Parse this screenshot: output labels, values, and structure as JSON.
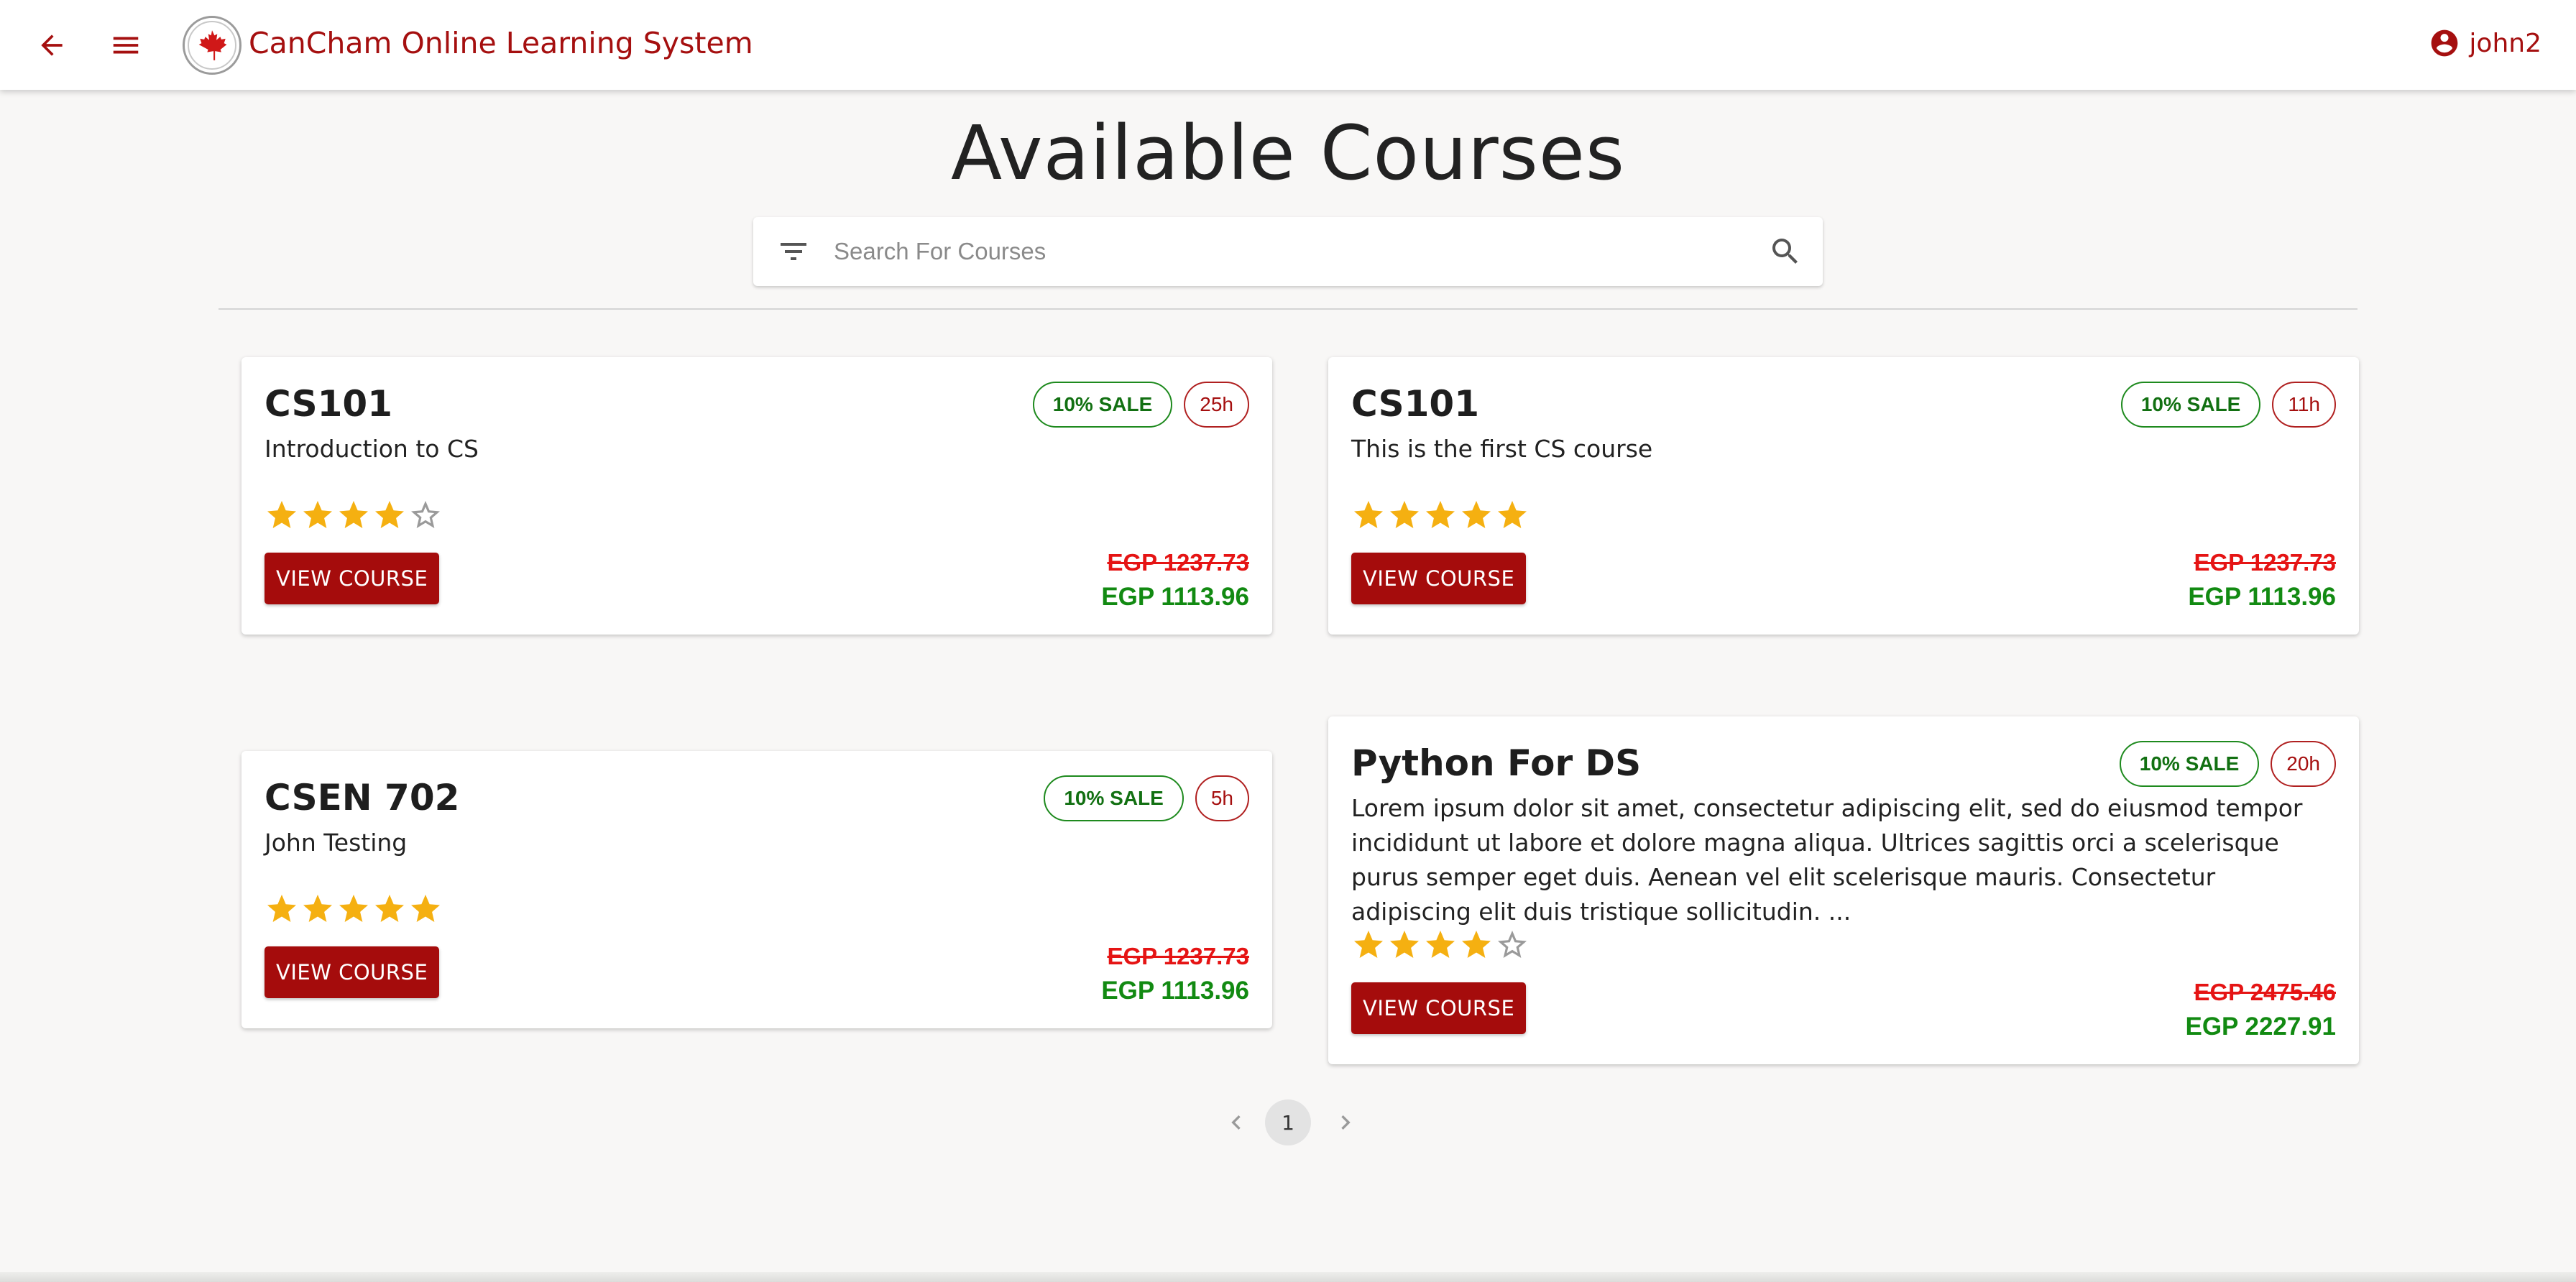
{
  "app": {
    "title": "CanCham Online Learning System",
    "user_name": "john2",
    "brand_color": "#a50f0f"
  },
  "page": {
    "title": "Available Courses",
    "search_placeholder": "Search For Courses"
  },
  "courses": [
    {
      "title": "CS101",
      "description": "Introduction to CS",
      "sale": "10% SALE",
      "duration": "25h",
      "rating": 4,
      "old_price": "EGP 1237.73",
      "new_price": "EGP 1113.96",
      "button": "VIEW COURSE"
    },
    {
      "title": "CS101",
      "description": "This is the first CS course",
      "sale": "10% SALE",
      "duration": "11h",
      "rating": 5,
      "old_price": "EGP 1237.73",
      "new_price": "EGP 1113.96",
      "button": "VIEW COURSE"
    },
    {
      "title": "CSEN 702",
      "description": "John Testing",
      "sale": "10% SALE",
      "duration": "5h",
      "rating": 5,
      "old_price": "EGP 1237.73",
      "new_price": "EGP 1113.96",
      "button": "VIEW COURSE"
    },
    {
      "title": "Python For DS",
      "description": "Lorem ipsum dolor sit amet, consectetur adipiscing elit, sed do eiusmod tempor incididunt ut labore et dolore magna aliqua. Ultrices sagittis orci a scelerisque purus semper eget duis. Aenean vel elit scelerisque mauris. Consectetur adipiscing elit duis tristique sollicitudin. ...",
      "sale": "10% SALE",
      "duration": "20h",
      "rating": 4,
      "old_price": "EGP 2475.46",
      "new_price": "EGP 2227.91",
      "button": "VIEW COURSE"
    }
  ],
  "pagination": {
    "current_page": "1"
  },
  "icons": {
    "back": "arrow-back-icon",
    "menu": "hamburger-menu-icon",
    "logo": "cancham-maple-leaf-logo",
    "user": "account-circle-icon",
    "filter": "filter-icon",
    "search": "search-icon",
    "star_filled": "star-filled-icon",
    "star_empty": "star-outline-icon"
  },
  "colors": {
    "sale_green": "#128a12",
    "price_strike_red": "#e51414",
    "star_gold": "#f5b011",
    "button_red": "#a50c0c"
  }
}
